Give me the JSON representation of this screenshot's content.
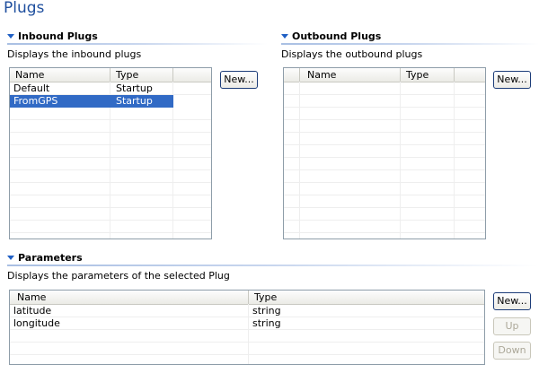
{
  "page": {
    "title": "Plugs"
  },
  "inbound": {
    "header": "Inbound Plugs",
    "description": "Displays the inbound plugs",
    "columns": [
      "Name",
      "Type"
    ],
    "rows": [
      {
        "name": "Default",
        "type": "Startup",
        "selected": false
      },
      {
        "name": "FromGPS",
        "type": "Startup",
        "selected": true
      }
    ],
    "new_label": "New..."
  },
  "outbound": {
    "header": "Outbound Plugs",
    "description": "Displays the outbound plugs",
    "columns": [
      "Name",
      "Type"
    ],
    "rows": [],
    "new_label": "New..."
  },
  "parameters": {
    "header": "Parameters",
    "description": "Displays the parameters of the selected Plug",
    "columns": [
      "Name",
      "Type"
    ],
    "rows": [
      {
        "name": "latitude",
        "type": "string"
      },
      {
        "name": "longitude",
        "type": "string"
      }
    ],
    "new_label": "New...",
    "up_label": "Up",
    "down_label": "Down"
  },
  "colors": {
    "title": "#1f4f9e",
    "selection": "#316ac5",
    "section_arrow": "#1f5fc4"
  }
}
